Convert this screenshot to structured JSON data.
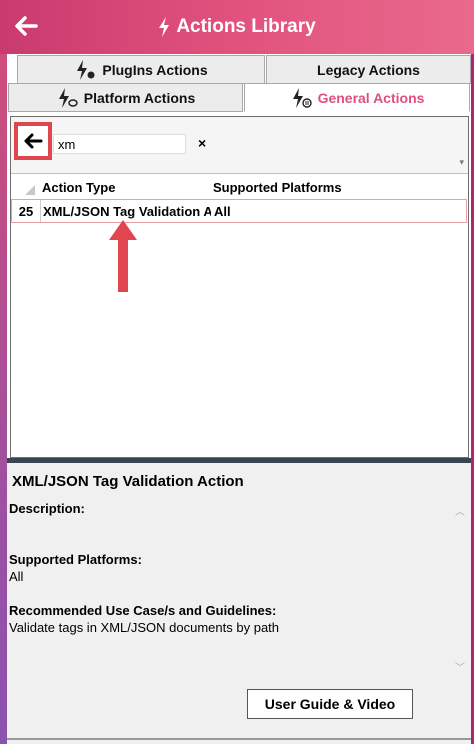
{
  "header": {
    "title": "Actions Library",
    "back_icon": "arrow-left-icon",
    "title_icon": "bolt-icon",
    "colors": {
      "gradient_start": "#c93a6e",
      "gradient_end": "#e96a8c"
    }
  },
  "tabs": [
    {
      "label": "PlugIns Actions",
      "icon": "plugin-bolt-icon",
      "active": false
    },
    {
      "label": "Legacy Actions",
      "icon": "",
      "active": false
    },
    {
      "label": "Platform Actions",
      "icon": "platform-bolt-icon",
      "active": false
    },
    {
      "label": "General Actions",
      "icon": "general-bolt-icon",
      "active": true
    }
  ],
  "search": {
    "value": "xm",
    "clear_label": "×",
    "back_icon": "arrow-left-icon",
    "highlight_color": "#e0464f"
  },
  "table": {
    "headers": {
      "action_type": "Action Type",
      "platforms": "Supported Platforms"
    },
    "rows": [
      {
        "num": "25",
        "action_type": "XML/JSON Tag Validation Action",
        "platforms": "All"
      }
    ]
  },
  "annotation": {
    "icon": "red-arrow-up-icon",
    "color": "#e0464f"
  },
  "details": {
    "title": "XML/JSON Tag Validation Action",
    "description_label": "Description:",
    "platforms_label": "Supported Platforms:",
    "platforms_value": "All",
    "guidelines_label": "Recommended Use Case/s and Guidelines:",
    "guidelines_value": "Validate tags in XML/JSON documents by path",
    "guide_button": "User Guide & Video"
  }
}
